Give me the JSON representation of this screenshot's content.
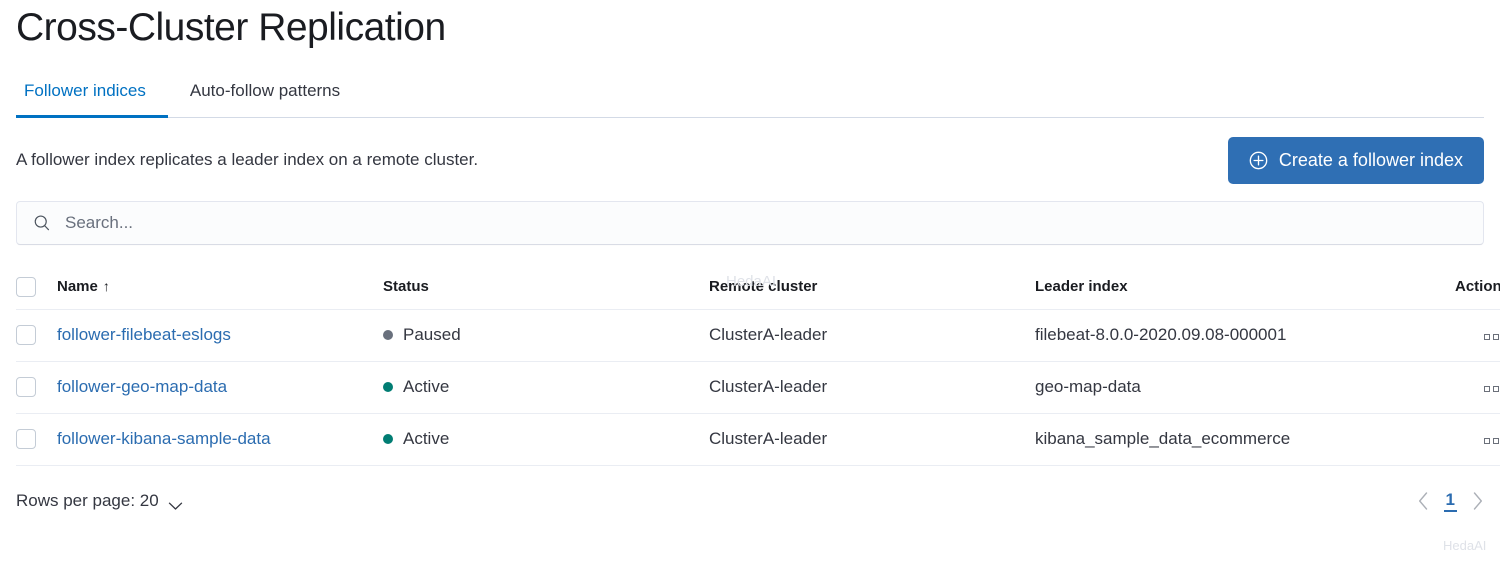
{
  "header": {
    "title": "Cross-Cluster Replication"
  },
  "tabs": [
    {
      "label": "Follower indices",
      "active": true
    },
    {
      "label": "Auto-follow patterns",
      "active": false
    }
  ],
  "description": {
    "text": "A follower index replicates a leader index on a remote cluster."
  },
  "toolbar": {
    "create_label": "Create a follower index",
    "create_icon": "plus-in-circle-icon",
    "accent_color": "#2f6fb4"
  },
  "search": {
    "placeholder": "Search...",
    "value": "",
    "icon": "search-icon"
  },
  "table": {
    "columns": [
      {
        "key": "name",
        "label": "Name",
        "sorted": "asc",
        "sort_glyph": "↑"
      },
      {
        "key": "status",
        "label": "Status"
      },
      {
        "key": "remote_cluster",
        "label": "Remote cluster"
      },
      {
        "key": "leader_index",
        "label": "Leader index"
      },
      {
        "key": "actions",
        "label": "Actions"
      }
    ],
    "rows": [
      {
        "name": "follower-filebeat-eslogs",
        "status": "Paused",
        "status_color": "#69707d",
        "remote_cluster": "ClusterA-leader",
        "leader_index": "filebeat-8.0.0-2020.09.08-000001",
        "actions_icon": "more-actions-icon"
      },
      {
        "name": "follower-geo-map-data",
        "status": "Active",
        "status_color": "#017d73",
        "remote_cluster": "ClusterA-leader",
        "leader_index": "geo-map-data",
        "actions_icon": "more-actions-icon"
      },
      {
        "name": "follower-kibana-sample-data",
        "status": "Active",
        "status_color": "#017d73",
        "remote_cluster": "ClusterA-leader",
        "leader_index": "kibana_sample_data_ecommerce",
        "actions_icon": "more-actions-icon"
      }
    ]
  },
  "footer": {
    "rows_per_page_label": "Rows per page: 20",
    "rows_per_page_value": "20",
    "current_page": "1",
    "prev_icon": "chevron-left-icon",
    "next_icon": "chevron-right-icon",
    "dropdown_icon": "chevron-down-icon"
  },
  "watermarks": {
    "one": "HedaAI",
    "two": "HedaAI"
  }
}
